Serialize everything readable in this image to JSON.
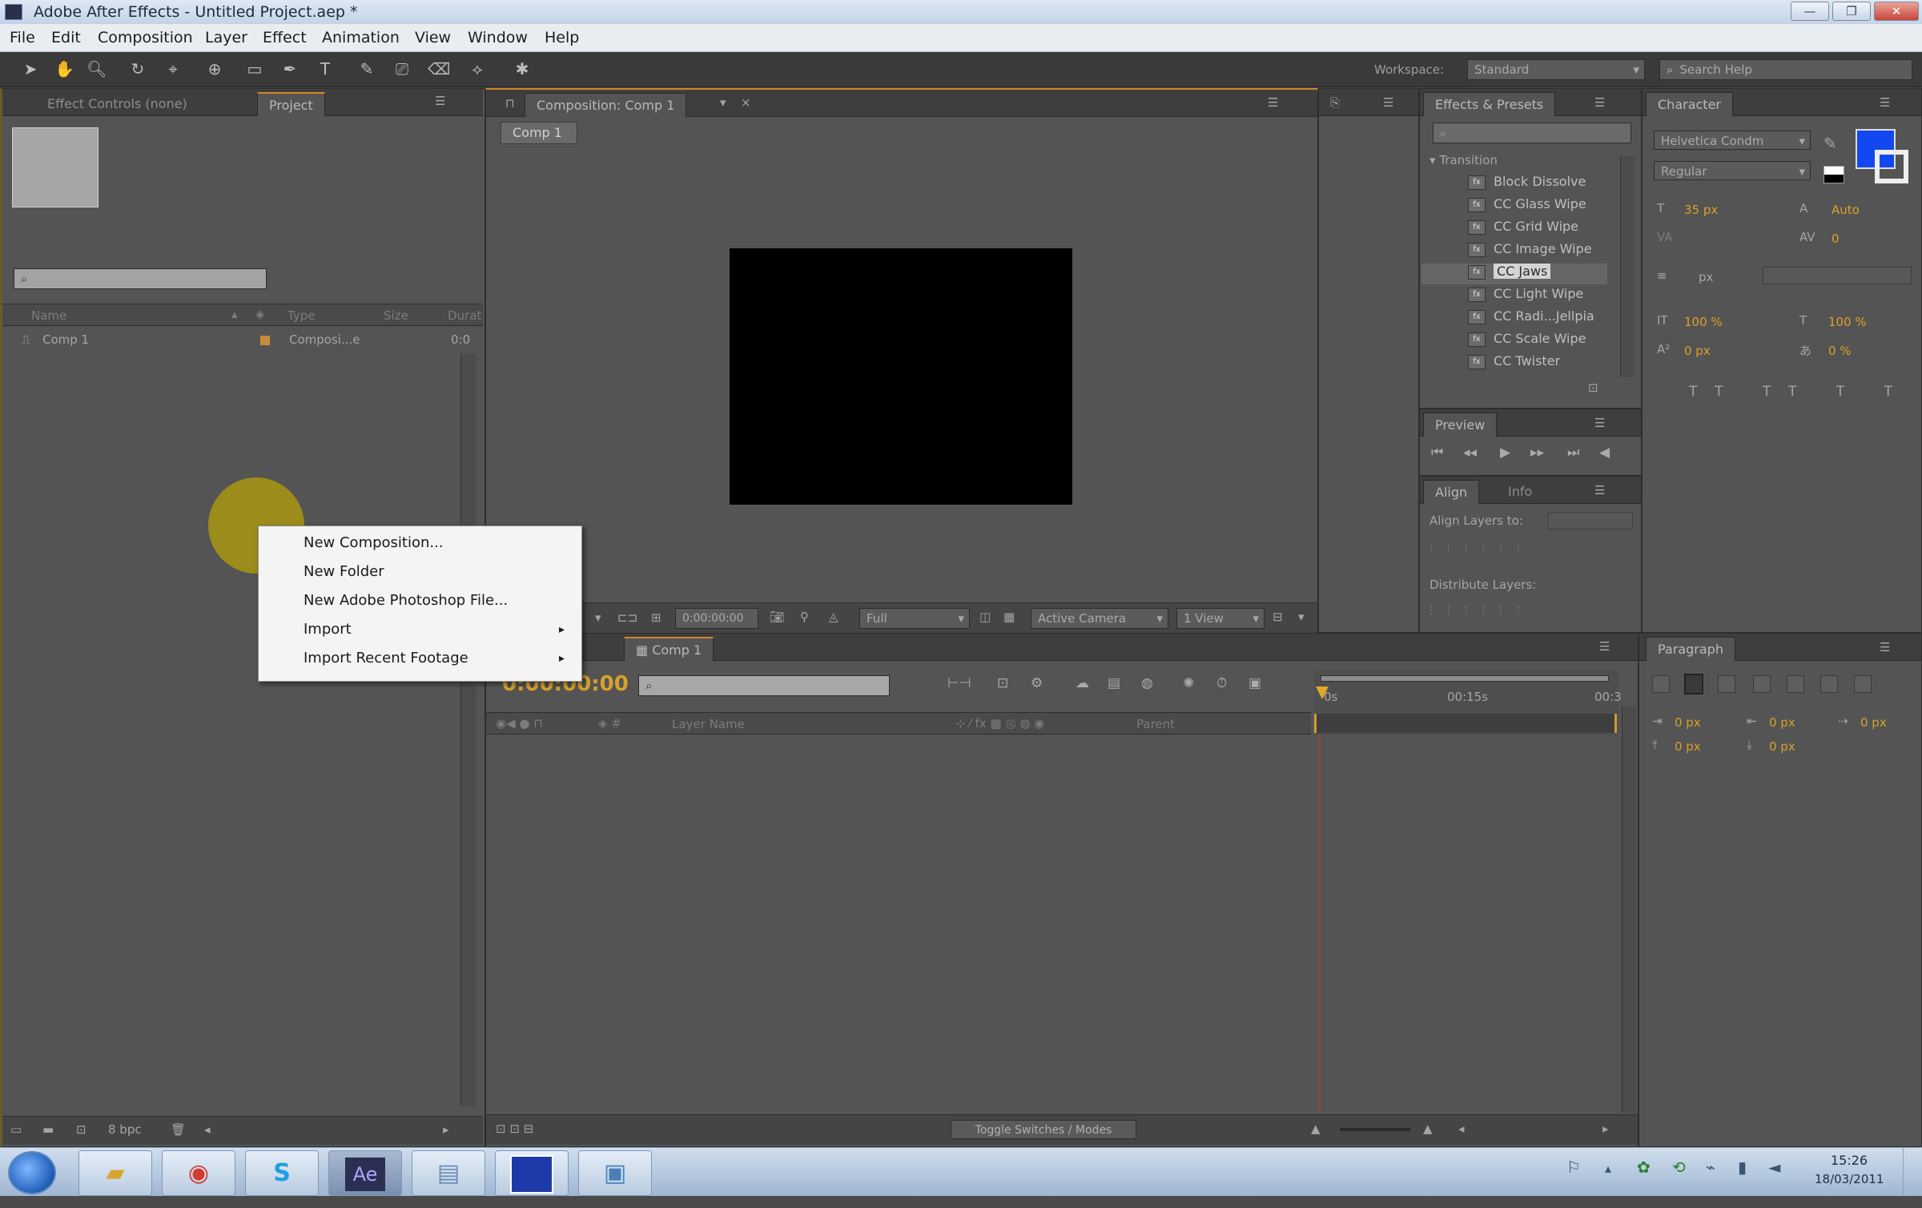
{
  "window": {
    "title": "Adobe After Effects - Untitled Project.aep *"
  },
  "menu": [
    "File",
    "Edit",
    "Composition",
    "Layer",
    "Effect",
    "Animation",
    "View",
    "Window",
    "Help"
  ],
  "toolbar": {
    "workspace_label": "Workspace:",
    "workspace_value": "Standard",
    "search_placeholder": "Search Help"
  },
  "project_panel": {
    "tabs": [
      "Effect Controls (none)",
      "Project"
    ],
    "columns": [
      "Name",
      "Type",
      "Size",
      "Durat"
    ],
    "items": [
      {
        "name": "Comp 1",
        "type": "Composi...e",
        "duration": "0:0"
      }
    ],
    "footer_bpc": "8 bpc"
  },
  "context_menu": {
    "items": [
      {
        "label": "New Composition...",
        "submenu": false
      },
      {
        "label": "New Folder",
        "submenu": false
      },
      {
        "label": "New Adobe Photoshop File...",
        "submenu": false
      },
      {
        "label": "Import",
        "submenu": true
      },
      {
        "label": "Import Recent Footage",
        "submenu": true
      }
    ],
    "arrow": "▸"
  },
  "composition_panel": {
    "tab": "Composition: Comp 1",
    "sub_tab": "Comp 1",
    "timecode": "0:00:00:00",
    "resolution": "Full",
    "camera": "Active Camera",
    "views": "1 View"
  },
  "effects_panel": {
    "tab": "Effects & Presets",
    "category": "Transition",
    "items": [
      "Block Dissolve",
      "CC Glass Wipe",
      "CC Grid Wipe",
      "CC Image Wipe",
      "CC Jaws",
      "CC Light Wipe",
      "CC Radi...Jellpia",
      "CC Scale Wipe",
      "CC Twister"
    ],
    "selected": "CC Jaws"
  },
  "preview_panel": {
    "tab": "Preview"
  },
  "align_panel": {
    "tabs": [
      "Align",
      "Info"
    ],
    "align_label": "Align Layers to:",
    "distribute_label": "Distribute Layers:"
  },
  "character_panel": {
    "tab": "Character",
    "font": "Helvetica Condm",
    "style": "Regular",
    "size": "35 px",
    "leading": "Auto",
    "tracking": "0",
    "stroke": "px",
    "v_scale": "100 %",
    "h_scale": "100 %",
    "baseline": "0 px",
    "tsume": "0 %",
    "fill_color": "#1348f0"
  },
  "paragraph_panel": {
    "tab": "Paragraph",
    "indent_1": "0 px",
    "indent_2": "0 px",
    "indent_3": "0 px",
    "space_1": "0 px",
    "space_2": "0 px"
  },
  "timeline": {
    "tab": "Comp 1",
    "timecode": "0:00:00:00",
    "col_layer": "Layer Name",
    "col_parent": "Parent",
    "ruler": [
      "0s",
      "00:15s",
      "00:3"
    ],
    "footer": "Toggle Switches / Modes",
    "playhead_color": "#c0392b"
  },
  "taskbar": {
    "apps": [
      "start",
      "explorer",
      "chrome",
      "skype",
      "after-effects",
      "shell",
      "app-blue",
      "app-image"
    ],
    "ae_label": "Ae",
    "time": "15:26",
    "date": "18/03/2011"
  }
}
